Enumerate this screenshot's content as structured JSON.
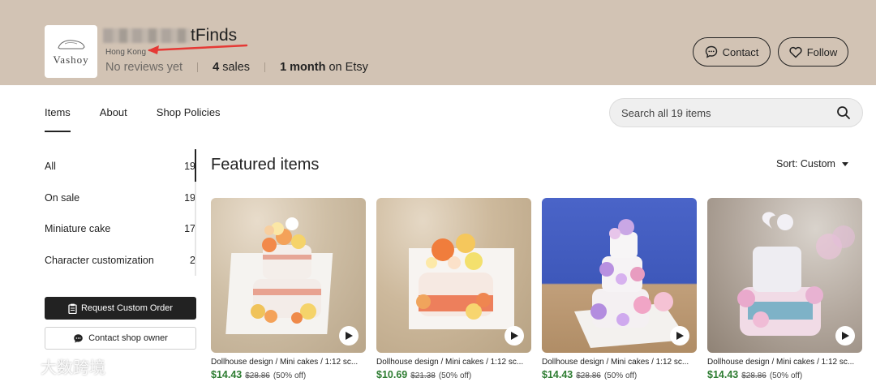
{
  "header": {
    "logo_text": "Vashoy",
    "shop_name": "tFinds",
    "location": "Hong Kong",
    "reviews": "No reviews yet",
    "sales_count": "4",
    "sales_label": "sales",
    "tenure_value": "1 month",
    "tenure_label": "on Etsy",
    "contact_label": "Contact",
    "follow_label": "Follow"
  },
  "tabs": [
    {
      "label": "Items"
    },
    {
      "label": "About"
    },
    {
      "label": "Shop Policies"
    }
  ],
  "search": {
    "placeholder": "Search all 19 items"
  },
  "sidebar": {
    "categories": [
      {
        "label": "All",
        "count": "19"
      },
      {
        "label": "On sale",
        "count": "19"
      },
      {
        "label": "Miniature cake",
        "count": "17"
      },
      {
        "label": "Character customization",
        "count": "2"
      }
    ],
    "request_label": "Request Custom Order",
    "owner_label": "Contact shop owner"
  },
  "main": {
    "title": "Featured items",
    "sort_label": "Sort: Custom"
  },
  "items": [
    {
      "title": "Dollhouse design / Mini cakes / 1:12 sc...",
      "price": "$14.43",
      "original": "$28.86",
      "discount": "(50% off)"
    },
    {
      "title": "Dollhouse design / Mini cakes / 1:12 sc...",
      "price": "$10.69",
      "original": "$21.38",
      "discount": "(50% off)"
    },
    {
      "title": "Dollhouse design / Mini cakes / 1:12 sc...",
      "price": "$14.43",
      "original": "$28.86",
      "discount": "(50% off)"
    },
    {
      "title": "Dollhouse design / Mini cakes / 1:12 sc...",
      "price": "$14.43",
      "original": "$28.86",
      "discount": "(50% off)"
    }
  ],
  "watermark": "大数跨境",
  "colors": {
    "banner": "#d2c3b4",
    "price_green": "#2e7d32",
    "annotation_arrow": "#e53935"
  }
}
